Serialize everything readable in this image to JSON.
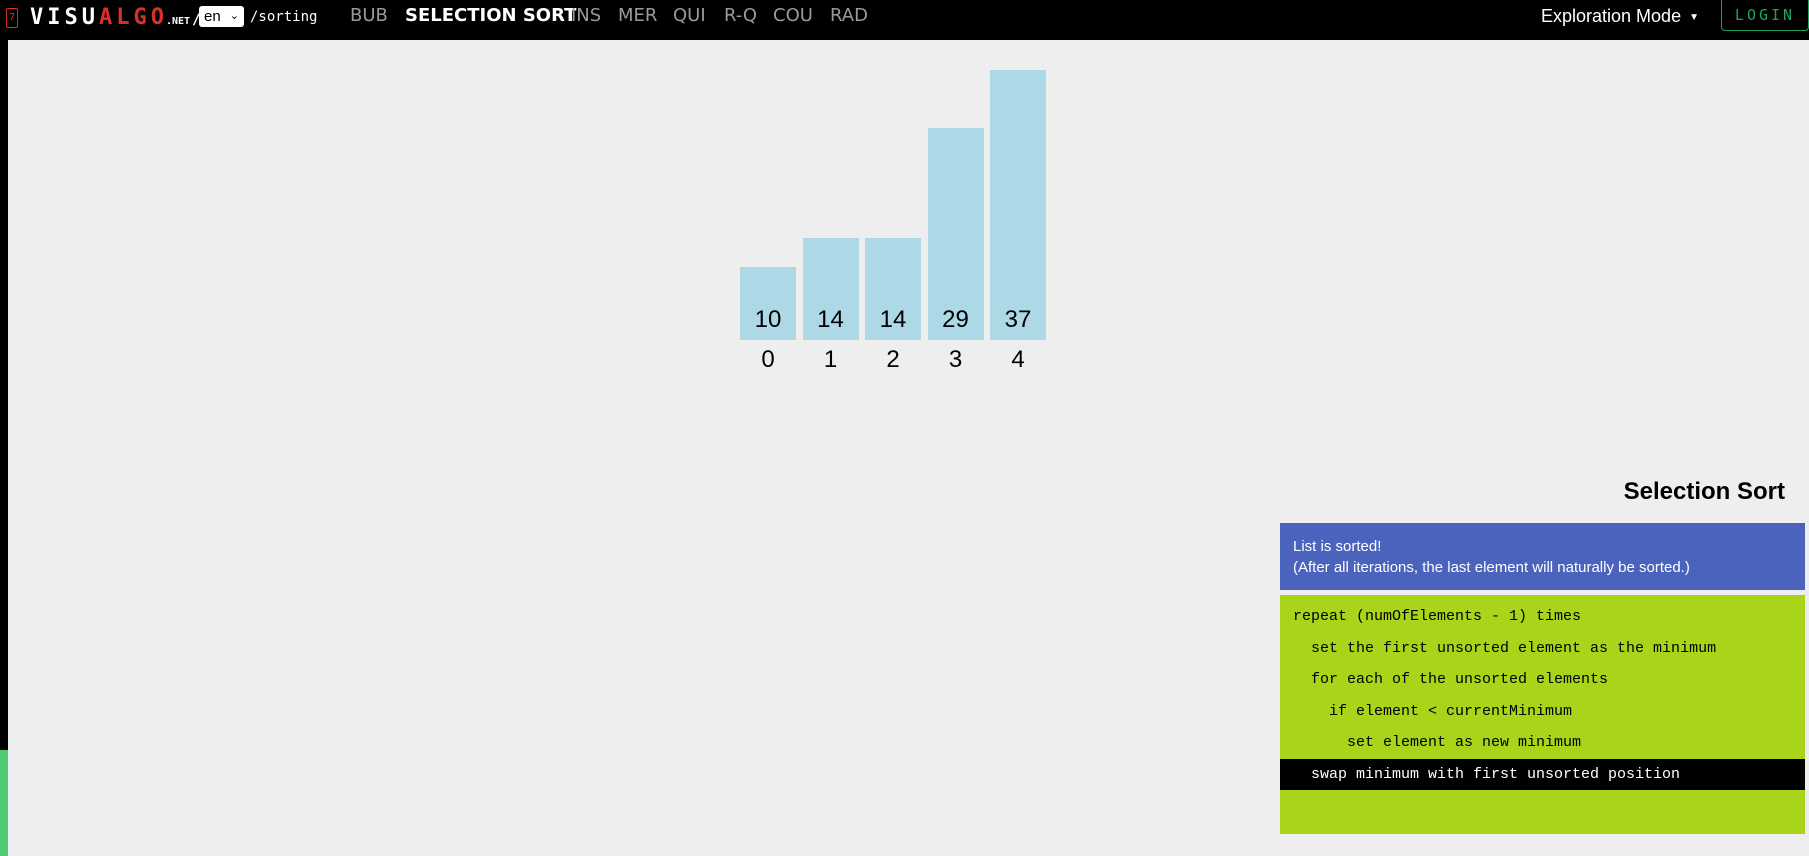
{
  "nav": {
    "logo_badge": "7",
    "logo_white": "VISU",
    "logo_red": "ALGO",
    "logo_net": ".NET",
    "logo_slash": "/",
    "lang": "en",
    "path": "/sorting",
    "links": [
      {
        "label": "BUB",
        "active": false
      },
      {
        "label": "SELECTION SORT",
        "active": true
      },
      {
        "label": "INS",
        "active": false
      },
      {
        "label": "MER",
        "active": false
      },
      {
        "label": "QUI",
        "active": false
      },
      {
        "label": "R-Q",
        "active": false
      },
      {
        "label": "COU",
        "active": false
      },
      {
        "label": "RAD",
        "active": false
      }
    ],
    "mode": "Exploration Mode",
    "login": "LOGIN"
  },
  "chart_data": {
    "type": "bar",
    "categories": [
      "0",
      "1",
      "2",
      "3",
      "4"
    ],
    "values": [
      10,
      14,
      14,
      29,
      37
    ],
    "title": "",
    "xlabel": "",
    "ylabel": "",
    "color": "#add8e6"
  },
  "panel": {
    "title": "Selection Sort",
    "status_line1": "List is sorted!",
    "status_line2": "(After all iterations, the last element will naturally be sorted.)",
    "code": [
      {
        "text": "repeat (numOfElements - 1) times",
        "highlighted": false
      },
      {
        "text": "  set the first unsorted element as the minimum",
        "highlighted": false
      },
      {
        "text": "  for each of the unsorted elements",
        "highlighted": false
      },
      {
        "text": "    if element < currentMinimum",
        "highlighted": false
      },
      {
        "text": "      set element as new minimum",
        "highlighted": false
      },
      {
        "text": "  swap minimum with first unsorted position",
        "highlighted": true
      }
    ]
  }
}
